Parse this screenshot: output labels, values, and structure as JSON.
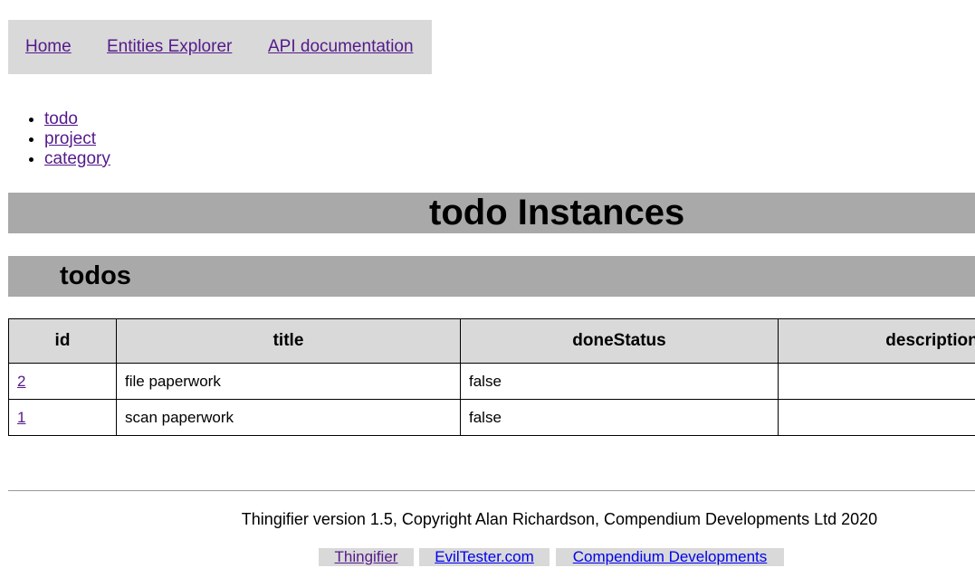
{
  "nav": {
    "home": "Home",
    "entities_explorer": "Entities Explorer",
    "api_docs": "API documentation"
  },
  "entity_links": [
    "todo",
    "project",
    "category"
  ],
  "page_title": "todo Instances",
  "section_title": "todos",
  "table": {
    "headers": [
      "id",
      "title",
      "doneStatus",
      "description"
    ],
    "rows": [
      {
        "id": "2",
        "title": "file paperwork",
        "doneStatus": "false",
        "description": ""
      },
      {
        "id": "1",
        "title": "scan paperwork",
        "doneStatus": "false",
        "description": ""
      }
    ]
  },
  "footer": {
    "copyright": "Thingifier version 1.5, Copyright Alan Richardson, Compendium Developments Ltd 2020",
    "links": [
      "Thingifier",
      "EvilTester.com",
      "Compendium Developments"
    ]
  },
  "colors": {
    "nav_bg": "#d9d9d9",
    "heading_bar_bg": "#a9a9a9",
    "visited_link": "#551a8b",
    "link": "#0000ee"
  }
}
